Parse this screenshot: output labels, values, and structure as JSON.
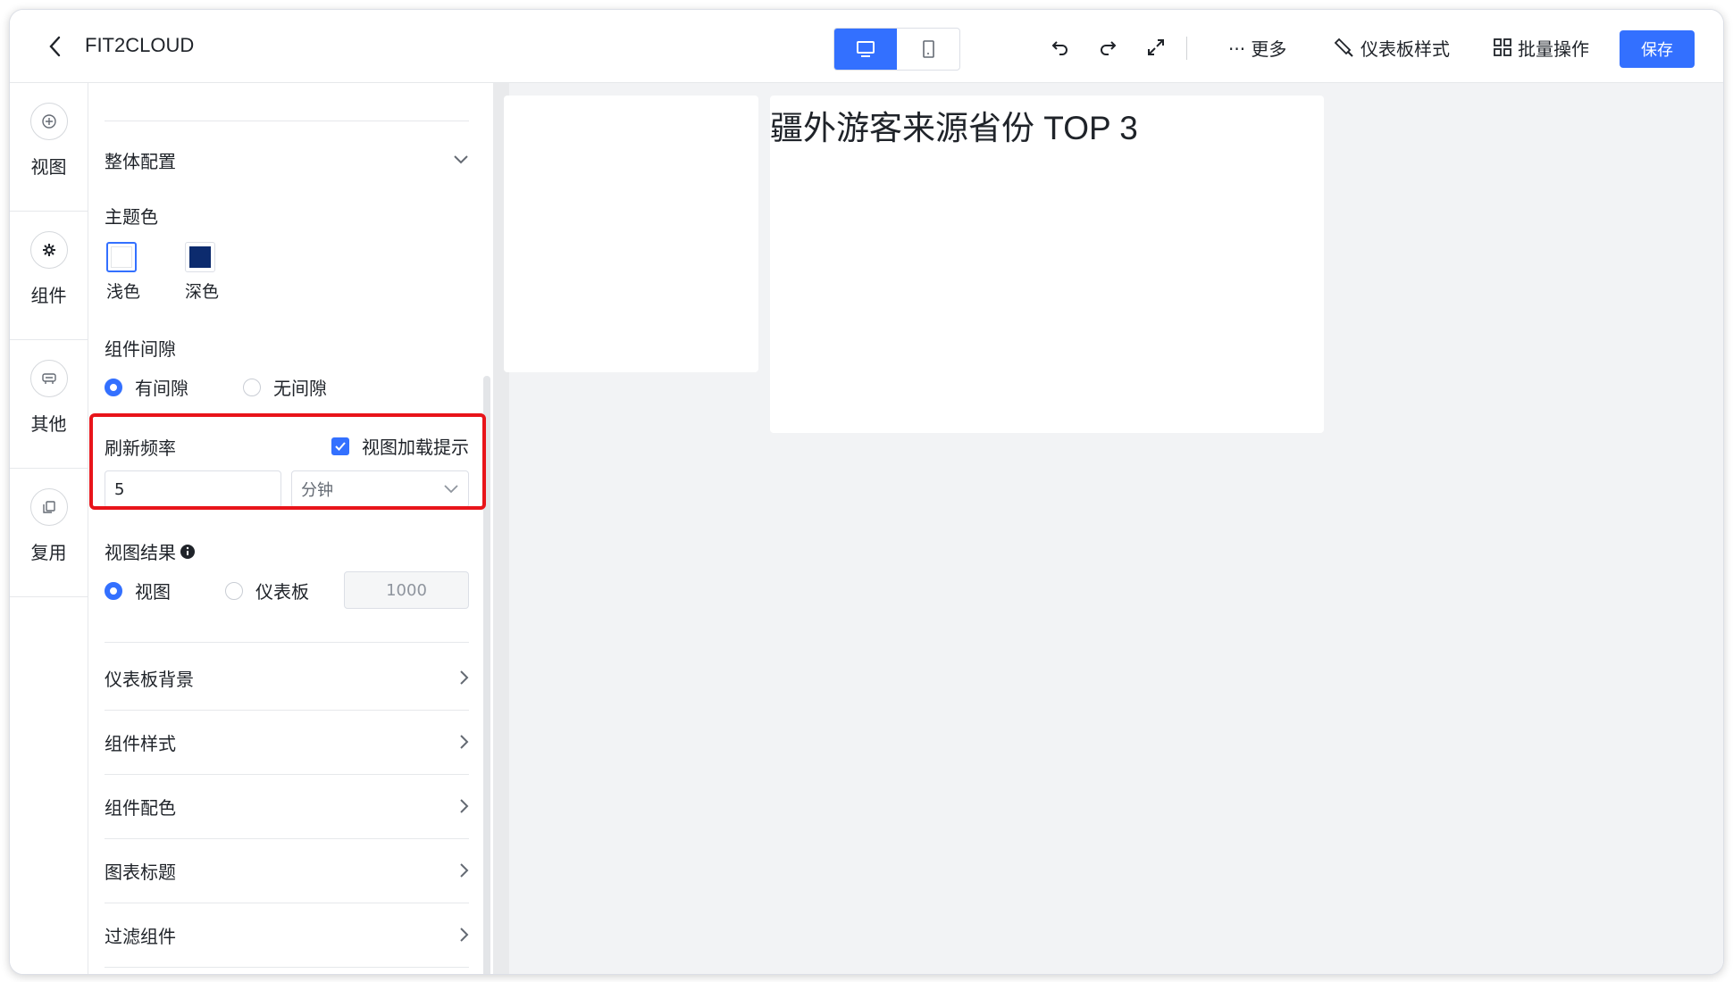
{
  "header": {
    "title": "FIT2CLOUD",
    "more_label": "··· 更多",
    "dashboard_style_label": "仪表板样式",
    "batch_label": "批量操作",
    "save_label": "保存"
  },
  "rail": {
    "items": [
      {
        "label": "视图",
        "icon": "plus-circle-icon"
      },
      {
        "label": "组件",
        "icon": "gear-icon"
      },
      {
        "label": "其他",
        "icon": "other-icon"
      },
      {
        "label": "复用",
        "icon": "copy-icon"
      }
    ]
  },
  "panel": {
    "overall_config": "整体配置",
    "theme_color_label": "主题色",
    "theme_light": "浅色",
    "theme_dark": "深色",
    "gap_label": "组件间隙",
    "gap_on": "有间隙",
    "gap_off": "无间隙",
    "refresh_label": "刷新频率",
    "view_load_tip": "视图加载提示",
    "refresh_value": "5",
    "refresh_unit": "分钟",
    "view_result_label": "视图结果",
    "result_view": "视图",
    "result_dashboard": "仪表板",
    "result_limit": "1000",
    "sections": [
      "仪表板背景",
      "组件样式",
      "组件配色",
      "图表标题",
      "过滤组件"
    ]
  },
  "canvas": {
    "card_title": "疆外游客来源省份 TOP 3"
  },
  "colors": {
    "accent": "#3370ff",
    "dark_theme": "#0c2b6e",
    "highlight": "#e8141a"
  }
}
